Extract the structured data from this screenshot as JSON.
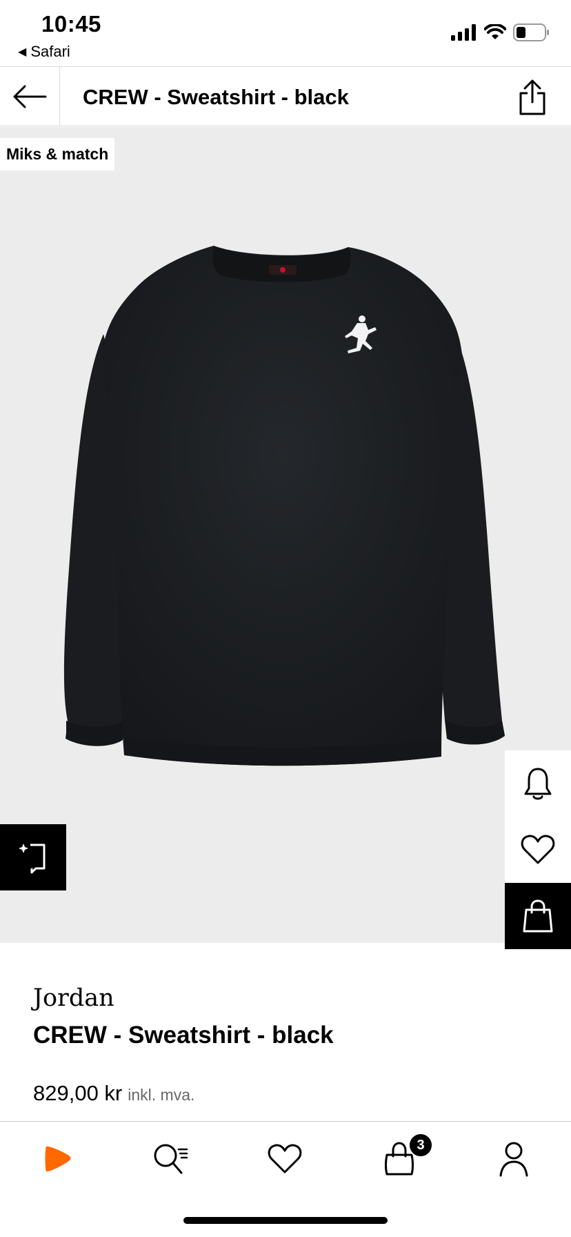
{
  "status_bar": {
    "time": "10:45",
    "back_app_label": "Safari",
    "icons": [
      "cellular-signal-icon",
      "wifi-icon",
      "battery-icon"
    ]
  },
  "header": {
    "title": "CREW - Sweatshirt - black",
    "back_icon": "arrow-left-icon",
    "share_icon": "share-icon"
  },
  "product_image": {
    "badge": "Miks & match",
    "image_index": 1,
    "image_count": 2
  },
  "actions": {
    "outfit_icon": "outfit-sparkle-icon",
    "notify_icon": "bell-icon",
    "wishlist_icon": "heart-icon",
    "add_to_bag_icon": "shopping-bag-icon"
  },
  "product": {
    "brand": "Jordan",
    "name": "CREW - Sweatshirt - black",
    "price": "829,00 kr",
    "vat_note": "inkl. mva."
  },
  "tab_bar": {
    "items": [
      {
        "name": "home",
        "icon": "zalando-logo-icon"
      },
      {
        "name": "search",
        "icon": "search-icon"
      },
      {
        "name": "wishlist",
        "icon": "heart-icon"
      },
      {
        "name": "bag",
        "icon": "shopping-bag-icon",
        "badge": "3"
      },
      {
        "name": "account",
        "icon": "user-icon"
      }
    ]
  },
  "colors": {
    "brand_orange": "#ff6900",
    "image_background": "#ececec",
    "sweatshirt": "#1b1d20"
  }
}
